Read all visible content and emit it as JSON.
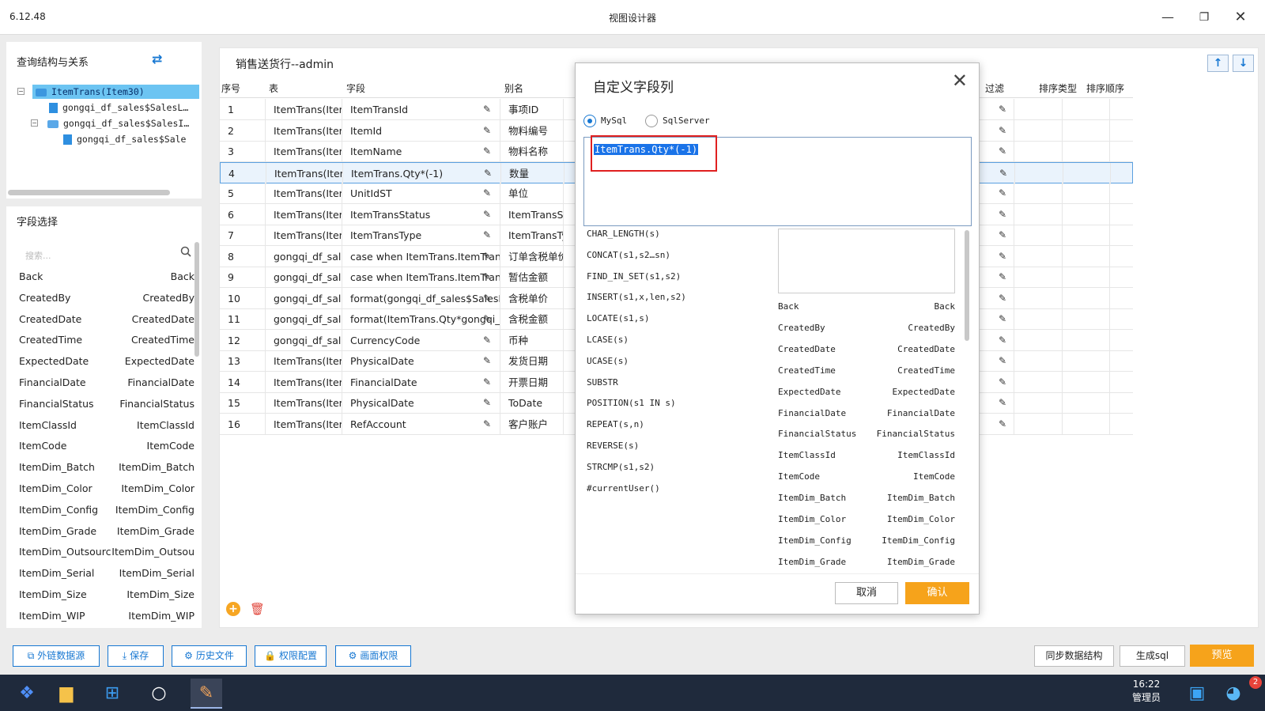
{
  "window": {
    "version": "6.12.48",
    "title": "视图设计器"
  },
  "tree_panel": {
    "title": "查询结构与关系",
    "items": [
      {
        "label": "ItemTrans(Item30)"
      },
      {
        "label": "gongqi_df_sales$SalesL…"
      },
      {
        "label": "gongqi_df_sales$SalesI…"
      },
      {
        "label": "gongqi_df_sales$Sale"
      }
    ]
  },
  "field_panel": {
    "title": "字段选择",
    "search_placeholder": "搜索...",
    "fields": [
      {
        "name": "Back",
        "label": "Back"
      },
      {
        "name": "CreatedBy",
        "label": "CreatedBy"
      },
      {
        "name": "CreatedDate",
        "label": "CreatedDate"
      },
      {
        "name": "CreatedTime",
        "label": "CreatedTime"
      },
      {
        "name": "ExpectedDate",
        "label": "ExpectedDate"
      },
      {
        "name": "FinancialDate",
        "label": "FinancialDate"
      },
      {
        "name": "FinancialStatus",
        "label": "FinancialStatus"
      },
      {
        "name": "ItemClassId",
        "label": "ItemClassId"
      },
      {
        "name": "ItemCode",
        "label": "ItemCode"
      },
      {
        "name": "ItemDim_Batch",
        "label": "ItemDim_Batch"
      },
      {
        "name": "ItemDim_Color",
        "label": "ItemDim_Color"
      },
      {
        "name": "ItemDim_Config",
        "label": "ItemDim_Config"
      },
      {
        "name": "ItemDim_Grade",
        "label": "ItemDim_Grade"
      },
      {
        "name": "ItemDim_Outsourcing",
        "label": "ItemDim_Outsou"
      },
      {
        "name": "ItemDim_Serial",
        "label": "ItemDim_Serial"
      },
      {
        "name": "ItemDim_Size",
        "label": "ItemDim_Size"
      },
      {
        "name": "ItemDim_WIP",
        "label": "ItemDim_WIP"
      }
    ]
  },
  "main": {
    "title": "销售送货行--admin",
    "up_icon": "arrow-up-icon",
    "down_icon": "arrow-down-icon",
    "columns": {
      "seq": "序号",
      "table": "表",
      "field": "字段",
      "alias": "别名",
      "filter": "过滤",
      "sort_type": "排序类型",
      "sort_order": "排序顺序"
    },
    "rows": [
      {
        "seq": "1",
        "table": "ItemTrans(Iter",
        "field": "ItemTransId",
        "alias": "事项ID"
      },
      {
        "seq": "2",
        "table": "ItemTrans(Iter",
        "field": "ItemId",
        "alias": "物料编号"
      },
      {
        "seq": "3",
        "table": "ItemTrans(Iter",
        "field": "ItemName",
        "alias": "物料名称"
      },
      {
        "seq": "4",
        "table": "ItemTrans(Iter",
        "field": "ItemTrans.Qty*(-1)",
        "alias": "数量"
      },
      {
        "seq": "5",
        "table": "ItemTrans(Iter",
        "field": "UnitIdST",
        "alias": "单位"
      },
      {
        "seq": "6",
        "table": "ItemTrans(Iter",
        "field": "ItemTransStatus",
        "alias": "ItemTransStat"
      },
      {
        "seq": "7",
        "table": "ItemTrans(Iter",
        "field": "ItemTransType",
        "alias": "ItemTransTyp"
      },
      {
        "seq": "8",
        "table": "gongqi_df_sal",
        "field": "case when ItemTrans.ItemTran",
        "alias": "订单含税单价"
      },
      {
        "seq": "9",
        "table": "gongqi_df_sal",
        "field": "case when ItemTrans.ItemTran",
        "alias": "暂估金额"
      },
      {
        "seq": "10",
        "table": "gongqi_df_sal",
        "field": "format(gongqi_df_sales$SalesI",
        "alias": "含税单价"
      },
      {
        "seq": "11",
        "table": "gongqi_df_sal",
        "field": "format(ItemTrans.Qty*gongqi_",
        "alias": "含税金额"
      },
      {
        "seq": "12",
        "table": "gongqi_df_sal",
        "field": "CurrencyCode",
        "alias": "币种"
      },
      {
        "seq": "13",
        "table": "ItemTrans(Iter",
        "field": "PhysicalDate",
        "alias": "发货日期"
      },
      {
        "seq": "14",
        "table": "ItemTrans(Iter",
        "field": "FinancialDate",
        "alias": "开票日期"
      },
      {
        "seq": "15",
        "table": "ItemTrans(Iter",
        "field": "PhysicalDate",
        "alias": "ToDate"
      },
      {
        "seq": "16",
        "table": "ItemTrans(Iter",
        "field": "RefAccount",
        "alias": "客户账户"
      }
    ],
    "selected_row": "4"
  },
  "dialog": {
    "title": "自定义字段列",
    "radio_mysql": "MySql",
    "radio_sqlserver": "SqlServer",
    "selected_db": "MySql",
    "expression": "ItemTrans.Qty*(-1)",
    "functions": [
      "CHAR_LENGTH(s)",
      "CONCAT(s1,s2…sn)",
      "FIND_IN_SET(s1,s2)",
      "INSERT(s1,x,len,s2)",
      "LOCATE(s1,s)",
      "LCASE(s)",
      "UCASE(s)",
      "SUBSTR",
      "POSITION(s1 IN s)",
      "REPEAT(s,n)",
      "REVERSE(s)",
      "STRCMP(s1,s2)",
      "#currentUser()"
    ],
    "fields": [
      {
        "name": "Back",
        "label": "Back"
      },
      {
        "name": "CreatedBy",
        "label": "CreatedBy"
      },
      {
        "name": "CreatedDate",
        "label": "CreatedDate"
      },
      {
        "name": "CreatedTime",
        "label": "CreatedTime"
      },
      {
        "name": "ExpectedDate",
        "label": "ExpectedDate"
      },
      {
        "name": "FinancialDate",
        "label": "FinancialDate"
      },
      {
        "name": "FinancialStatus",
        "label": "FinancialStatus"
      },
      {
        "name": "ItemClassId",
        "label": "ItemClassId"
      },
      {
        "name": "ItemCode",
        "label": "ItemCode"
      },
      {
        "name": "ItemDim_Batch",
        "label": "ItemDim_Batch"
      },
      {
        "name": "ItemDim_Color",
        "label": "ItemDim_Color"
      },
      {
        "name": "ItemDim_Config",
        "label": "ItemDim_Config"
      },
      {
        "name": "ItemDim_Grade",
        "label": "ItemDim_Grade"
      }
    ],
    "cancel_label": "取消",
    "ok_label": "确认"
  },
  "toolbar": {
    "external_source": "外链数据源",
    "save": "保存",
    "history": "历史文件",
    "permission_config": "权限配置",
    "screen_permission": "画面权限",
    "sync_structure": "同步数据结构",
    "generate_sql": "生成sql",
    "preview": "预览"
  },
  "taskbar": {
    "time": "16:22",
    "user": "管理员",
    "badge": "2"
  },
  "colors": {
    "accent": "#1677d2",
    "primary_button": "#f6a31b",
    "selection": "#6cc4f2",
    "highlight": "#e02020"
  }
}
